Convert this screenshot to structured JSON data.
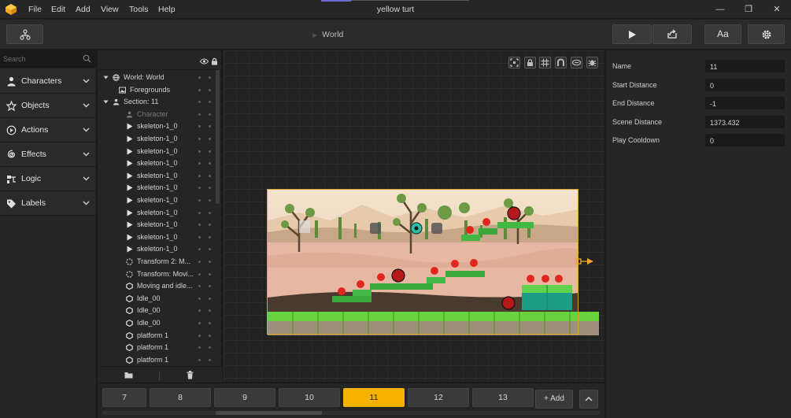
{
  "app": {
    "window_title": "yellow turt",
    "menu": [
      "File",
      "Edit",
      "Add",
      "View",
      "Tools",
      "Help"
    ],
    "window_controls": {
      "minimize": "—",
      "maximize": "❐",
      "close": "✕"
    }
  },
  "toolbar": {
    "breadcrumb": "World",
    "text_button_label": "Aa"
  },
  "sidebar": {
    "search_placeholder": "Search",
    "categories": [
      {
        "label": "Characters",
        "icon": "person-icon"
      },
      {
        "label": "Objects",
        "icon": "objects-icon"
      },
      {
        "label": "Actions",
        "icon": "play-circle-icon"
      },
      {
        "label": "Effects",
        "icon": "swirl-icon"
      },
      {
        "label": "Logic",
        "icon": "logic-icon"
      },
      {
        "label": "Labels",
        "icon": "tag-icon"
      }
    ]
  },
  "tree": {
    "items": [
      {
        "label": "World: World",
        "icon": "globe-icon",
        "level": 0,
        "expanded": true
      },
      {
        "label": "Foregrounds",
        "icon": "image-icon",
        "level": 1
      },
      {
        "label": "Section: 11",
        "icon": "section-icon",
        "level": 0,
        "expanded": true
      },
      {
        "label": "Character",
        "icon": "person-icon",
        "level": 2,
        "dim": true
      },
      {
        "label": "skeleton-1_0",
        "icon": "play-icon",
        "level": 2
      },
      {
        "label": "skeleton-1_0",
        "icon": "play-icon",
        "level": 2
      },
      {
        "label": "skeleton-1_0",
        "icon": "play-icon",
        "level": 2
      },
      {
        "label": "skeleton-1_0",
        "icon": "play-icon",
        "level": 2
      },
      {
        "label": "skeleton-1_0",
        "icon": "play-icon",
        "level": 2
      },
      {
        "label": "skeleton-1_0",
        "icon": "play-icon",
        "level": 2
      },
      {
        "label": "skeleton-1_0",
        "icon": "play-icon",
        "level": 2
      },
      {
        "label": "skeleton-1_0",
        "icon": "play-icon",
        "level": 2
      },
      {
        "label": "skeleton-1_0",
        "icon": "play-icon",
        "level": 2
      },
      {
        "label": "skeleton-1_0",
        "icon": "play-icon",
        "level": 2
      },
      {
        "label": "skeleton-1_0",
        "icon": "play-icon",
        "level": 2
      },
      {
        "label": "Transform 2: M...",
        "icon": "transform-icon",
        "level": 2
      },
      {
        "label": "Transform: Movi...",
        "icon": "transform-icon",
        "level": 2
      },
      {
        "label": "Moving and idle...",
        "icon": "hexagon-icon",
        "level": 2
      },
      {
        "label": "Idle_00",
        "icon": "hexagon-icon",
        "level": 2
      },
      {
        "label": "Idle_00",
        "icon": "hexagon-icon",
        "level": 2
      },
      {
        "label": "Idle_00",
        "icon": "hexagon-icon",
        "level": 2
      },
      {
        "label": "platform 1",
        "icon": "hexagon-icon",
        "level": 2
      },
      {
        "label": "platform 1",
        "icon": "hexagon-icon",
        "level": 2
      },
      {
        "label": "platform 1",
        "icon": "hexagon-icon",
        "level": 2
      }
    ]
  },
  "properties": [
    {
      "label": "Name",
      "value": "11"
    },
    {
      "label": "Start Distance",
      "value": "0"
    },
    {
      "label": "End Distance",
      "value": "-1"
    },
    {
      "label": "Scene Distance",
      "value": "1373.432"
    },
    {
      "label": "Play Cooldown",
      "value": "0"
    }
  ],
  "sections": {
    "tabs": [
      "7",
      "8",
      "9",
      "10",
      "11",
      "12",
      "13"
    ],
    "active": "11",
    "add_label": "+ Add"
  },
  "colors": {
    "accent": "#f5b300",
    "frame": "#d8a12a",
    "background": "#1e1e1e"
  }
}
